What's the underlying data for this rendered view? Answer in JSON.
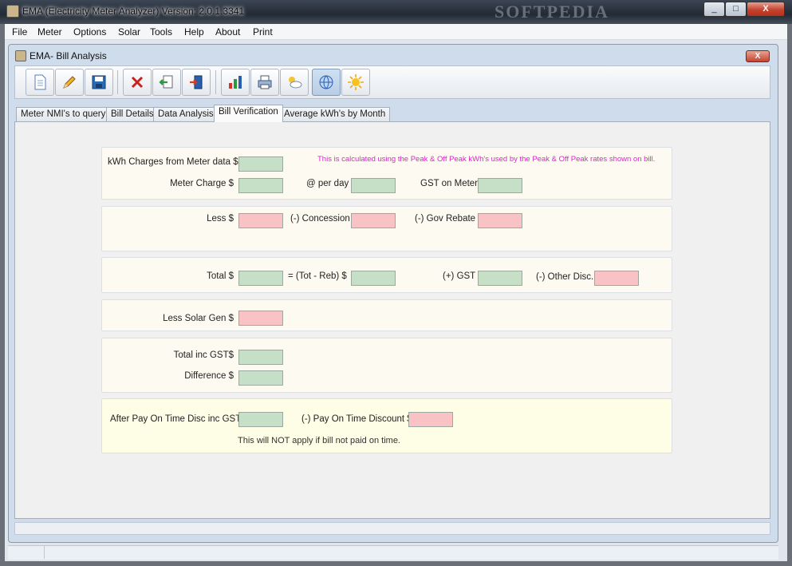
{
  "window": {
    "title": "EMA (Electricity Meter Analyzer) Version: 2.0.1.3341",
    "watermark": "SOFTPEDIA",
    "min": "_",
    "max": "□",
    "close": "X"
  },
  "menu": [
    "File",
    "Meter",
    "Options",
    "Solar",
    "Tools",
    "Help",
    "About",
    "Print"
  ],
  "child": {
    "title": "EMA- Bill Analysis",
    "close": "X"
  },
  "toolbar": [
    "new-document-icon",
    "edit-pencil-icon",
    "save-disk-icon",
    "delete-x-icon",
    "import-arrow-icon",
    "exit-door-icon",
    "bar-chart-icon",
    "printer-icon",
    "weather-cloud-icon",
    "globe-icon",
    "sun-icon"
  ],
  "tabs": [
    "Meter NMI's to query",
    "Bill Details",
    "Data Analysis",
    "Bill Verification",
    "Average kWh's by Month"
  ],
  "active_tab": "Bill Verification",
  "g1": {
    "kwh_label": "kWh Charges from Meter data  $",
    "note": "This is calculated using the Peak & Off Peak kWh's used by the Peak & Off Peak rates shown on bill.",
    "meter_charge": "Meter Charge $",
    "per_day": "@ per day",
    "gst_meter": "GST on Meter"
  },
  "g2": {
    "less": "Less $",
    "concession": "(-) Concession",
    "gov_rebate": "(-) Gov Rebate"
  },
  "g3": {
    "total": "Total $",
    "tot_reb": "= (Tot - Reb) $",
    "plus_gst": "(+) GST",
    "other_disc": "(-) Other Disc."
  },
  "g4": {
    "solar": "Less Solar Gen $"
  },
  "g5": {
    "total_inc": "Total inc GST$",
    "difference": "Difference $"
  },
  "g6": {
    "after_pay": "After Pay On Time Disc inc GST$",
    "pay_disc": "(-) Pay On Time Discount $",
    "note": "This will NOT apply if bill not paid on time."
  },
  "colors": {
    "green_field": "#c6e0c8",
    "pink_field": "#f9c3c6",
    "note_magenta": "#e020d0",
    "group_bg": "#fdfaf1"
  }
}
